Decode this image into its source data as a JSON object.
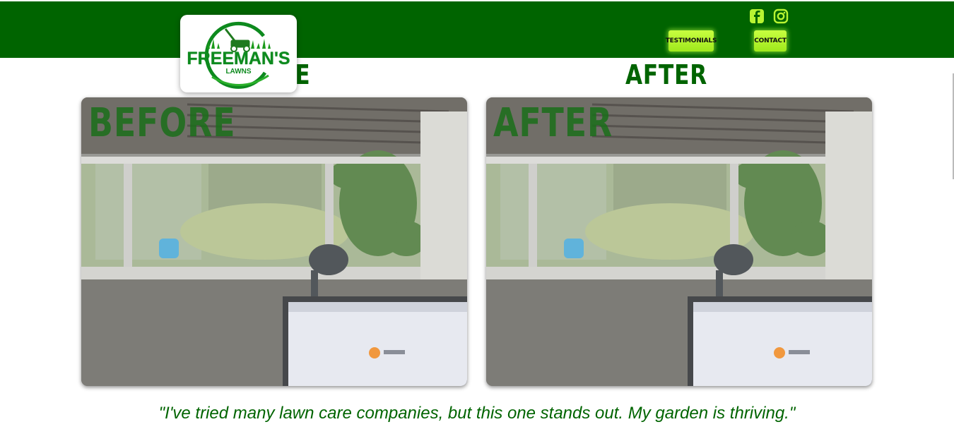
{
  "brand": {
    "logo_title": "FREEMAN'S",
    "logo_sub": "LAWNS",
    "primary_color": "#006400",
    "accent_color": "#b8f432"
  },
  "social": [
    {
      "icon": "facebook-icon"
    },
    {
      "icon": "instagram-icon"
    }
  ],
  "nav": {
    "testimonials": "TESTIMONIALS",
    "contact": "CONTACT"
  },
  "gallery": {
    "before_heading": "BEFORE",
    "after_heading": "AFTER",
    "before_overlay": "BEFORE",
    "after_overlay": "AFTER"
  },
  "testimonial": {
    "quote": "\"I've tried many lawn care companies, but this one stands out. My garden is thriving.\""
  }
}
